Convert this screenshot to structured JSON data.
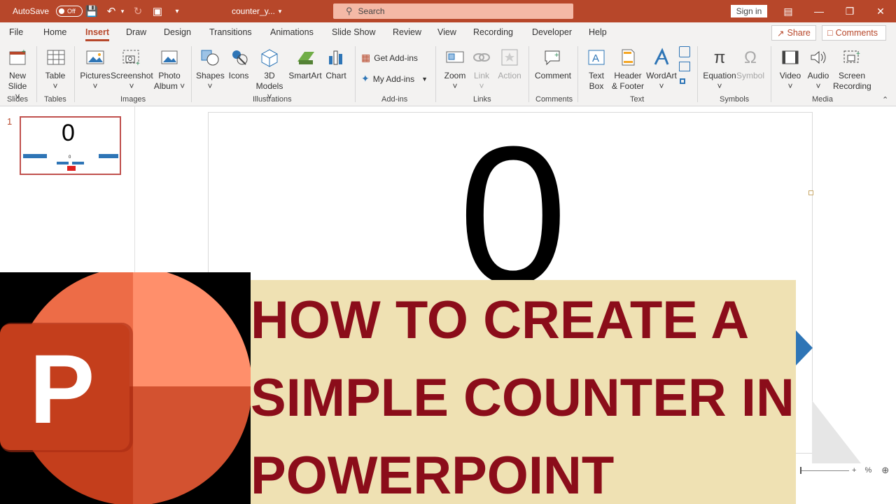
{
  "titlebar": {
    "autosave_label": "AutoSave",
    "autosave_state": "Off",
    "filename": "counter_y...",
    "search_placeholder": "Search",
    "signin_label": "Sign in",
    "bg_color": "#b7472a"
  },
  "tabs": [
    "File",
    "Home",
    "Insert",
    "Draw",
    "Design",
    "Transitions",
    "Animations",
    "Slide Show",
    "Review",
    "View",
    "Recording",
    "Developer",
    "Help"
  ],
  "active_tab": "Insert",
  "share_label": "Share",
  "comments_label": "Comments",
  "ribbon": {
    "new_slide": [
      "New",
      "Slide"
    ],
    "table": "Table",
    "pictures": "Pictures",
    "screenshot": "Screenshot",
    "photo_album": [
      "Photo",
      "Album"
    ],
    "shapes": "Shapes",
    "icons": "Icons",
    "models_3d": [
      "3D",
      "Models"
    ],
    "smartart": "SmartArt",
    "chart": "Chart",
    "get_addins": "Get Add-ins",
    "my_addins": "My Add-ins",
    "zoom": "Zoom",
    "link": "Link",
    "action": "Action",
    "comment": "Comment",
    "text_box": [
      "Text",
      "Box"
    ],
    "header_footer": [
      "Header",
      "& Footer"
    ],
    "wordart": "WordArt",
    "equation": "Equation",
    "symbol": "Symbol",
    "video": "Video",
    "audio": "Audio",
    "screen_recording": [
      "Screen",
      "Recording"
    ],
    "groups": {
      "slides": "Slides",
      "tables": "Tables",
      "images": "Images",
      "illustrations": "Illustrations",
      "addins": "Add-ins",
      "links": "Links",
      "comments": "Comments",
      "text": "Text",
      "symbols": "Symbols",
      "media": "Media"
    }
  },
  "slide_pane": {
    "slide_number": "1",
    "thumb_counter": "0",
    "thumb_small_counter": "0"
  },
  "slide": {
    "counter_value": "0"
  },
  "banner": {
    "lines": [
      "HOW TO CREATE A",
      "SIMPLE COUNTER IN",
      "POWERPOINT"
    ],
    "text_color": "#8b0d1a",
    "bg_color": "#efe1b3"
  },
  "status": {
    "zoom_text": "%"
  },
  "icons": {
    "accent": "#b7472a",
    "blue": "#2e75b6",
    "logo_orange": "#e8684a",
    "logo_dark": "#c43e1c"
  }
}
